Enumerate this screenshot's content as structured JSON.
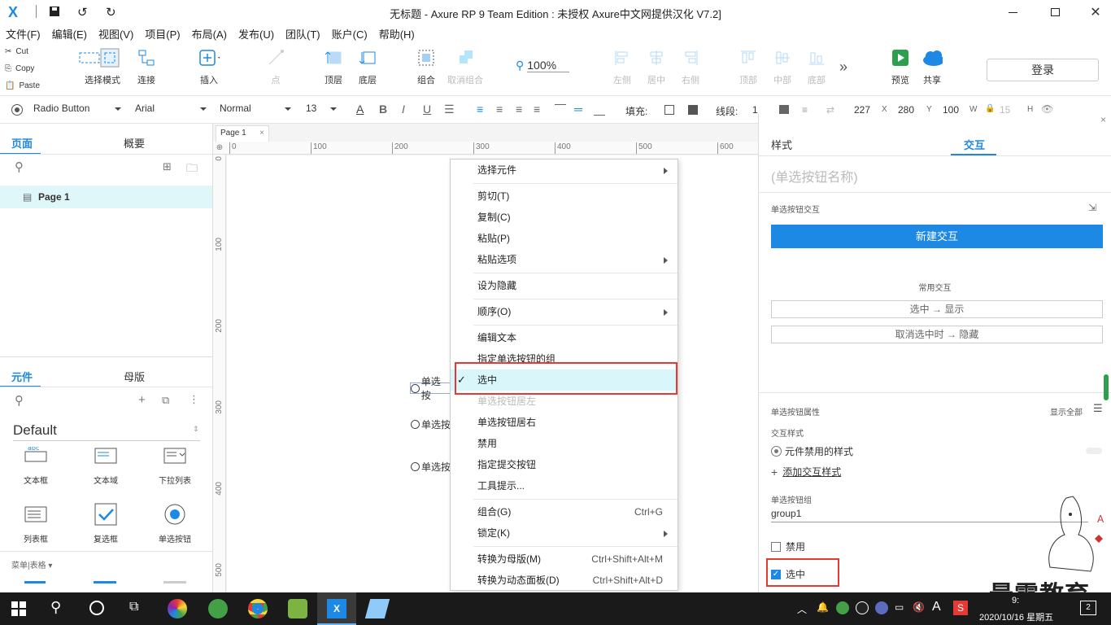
{
  "title": "无标题 - Axure RP 9 Team Edition : 未授权    Axure中文网提供汉化 V7.2]",
  "menu": [
    "文件(F)",
    "编辑(E)",
    "视图(V)",
    "项目(P)",
    "布局(A)",
    "发布(U)",
    "团队(T)",
    "账户(C)",
    "帮助(H)"
  ],
  "toolbar": {
    "cut": "Cut",
    "copy": "Copy",
    "paste": "Paste",
    "select_mode": "选择模式",
    "connect": "连接",
    "insert": "插入",
    "point": "点",
    "top": "顶层",
    "bottom": "底层",
    "group": "组合",
    "ungroup": "取消组合",
    "zoom": "100%",
    "left": "左侧",
    "center": "居中",
    "right": "右侧",
    "vtop": "顶部",
    "vmiddle": "中部",
    "vbottom": "底部",
    "preview": "预览",
    "share": "共享",
    "login": "登录"
  },
  "stylebar": {
    "widget_type": "Radio Button",
    "font": "Arial",
    "weight": "Normal",
    "size": "13",
    "fill_label": "填充:",
    "line_label": "线段:",
    "line_value": "1",
    "x": "227",
    "x_label": "X",
    "y": "280",
    "y_label": "Y",
    "w": "100",
    "w_label": "W",
    "h": "15",
    "h_label": "H"
  },
  "pages_panel": {
    "tab_pages": "页面",
    "tab_outline": "概要",
    "page1": "Page 1"
  },
  "widgets_panel": {
    "tab_widgets": "元件",
    "tab_masters": "母版",
    "library": "Default",
    "items": [
      "文本框",
      "文本域",
      "下拉列表",
      "列表框",
      "复选框",
      "单选按钮"
    ],
    "section": "菜单|表格 ▾"
  },
  "canvas": {
    "tab": "Page 1",
    "ruler_h": [
      "0",
      "100",
      "200",
      "300",
      "400",
      "500",
      "600"
    ],
    "ruler_v": [
      "0",
      "100",
      "200",
      "300",
      "400",
      "500"
    ],
    "radio_labels": [
      "单选按",
      "单选按",
      "单选按"
    ]
  },
  "context_menu": {
    "items": [
      {
        "label": "选择元件",
        "arrow": true
      },
      {
        "label": "剪切(T)"
      },
      {
        "label": "复制(C)"
      },
      {
        "label": "粘贴(P)"
      },
      {
        "label": "粘贴选项",
        "arrow": true
      },
      {
        "label": "设为隐藏"
      },
      {
        "label": "顺序(O)",
        "arrow": true
      },
      {
        "label": "编辑文本"
      },
      {
        "label": "指定单选按钮的组"
      },
      {
        "label": "选中",
        "checked": true
      },
      {
        "label": "单选按钮居左",
        "disabled": true
      },
      {
        "label": "单选按钮居右"
      },
      {
        "label": "禁用"
      },
      {
        "label": "指定提交按钮"
      },
      {
        "label": "工具提示..."
      },
      {
        "label": "组合(G)",
        "shortcut": "Ctrl+G"
      },
      {
        "label": "锁定(K)",
        "arrow": true
      },
      {
        "label": "转换为母版(M)",
        "shortcut": "Ctrl+Shift+Alt+M"
      },
      {
        "label": "转换为动态面板(D)",
        "shortcut": "Ctrl+Shift+Alt+D"
      }
    ]
  },
  "right_panel": {
    "tab_style": "样式",
    "tab_interaction": "交互",
    "name_placeholder": "(单选按钮名称)",
    "interaction_title": "单选按钮交互",
    "new_interaction": "新建交互",
    "common": "常用交互",
    "common1": "选中 → 显示",
    "common2": "取消选中时 → 隐藏",
    "props_title": "单选按钮属性",
    "show_all": "显示全部",
    "interaction_style": "交互样式",
    "disabled_style": "元件禁用的样式",
    "add_style": "添加交互样式",
    "group_label": "单选按钮组",
    "group_value": "group1",
    "disabled": "禁用",
    "selected": "选中"
  },
  "watermark": "最需教育",
  "taskbar": {
    "time": "9:",
    "date": "2020/10/16 星期五",
    "ime": "A",
    "badge": "2"
  },
  "colors": {
    "accent": "#1e88e5",
    "highlight_border": "#e53935",
    "menu_highlight": "#d9f6fa",
    "selected_page": "#e0f7fa"
  }
}
